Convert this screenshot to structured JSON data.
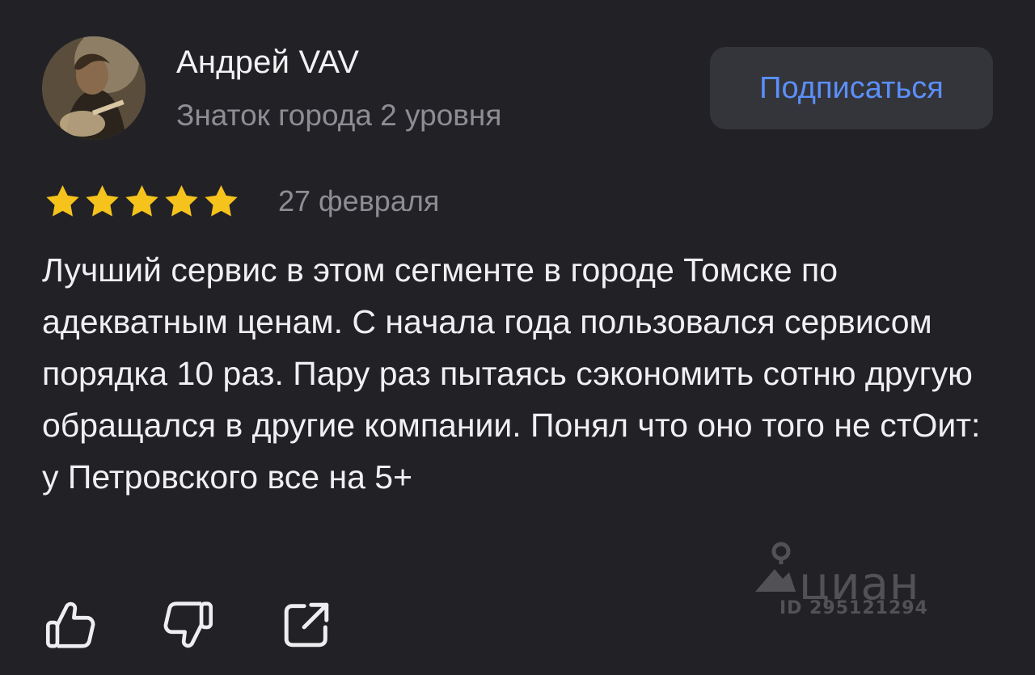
{
  "author": {
    "name": "Андрей VAV",
    "level": "Знаток города 2 уровня"
  },
  "subscribe_label": "Подписаться",
  "review": {
    "rating": 5,
    "rating_max": 5,
    "date": "27 февраля",
    "text": "Лучший сервис в этом сегменте в городе Томске по адекватным ценам. С начала года пользовался сервисом порядка 10 раз. Пару раз пытаясь сэкономить сотню другую обращался в другие компании. Понял что оно того не стОит: у Петровского все на 5+"
  },
  "watermark": {
    "brand": "циан",
    "id": "ID 295121294"
  },
  "actions": {
    "like_icon": "thumbs-up-icon",
    "dislike_icon": "thumbs-down-icon",
    "share_icon": "share-icon"
  },
  "colors": {
    "background": "#222226",
    "star": "#f6c31d",
    "accent": "#5b8ff9",
    "muted_text": "#8d8d94",
    "button_bg": "#34353b"
  }
}
